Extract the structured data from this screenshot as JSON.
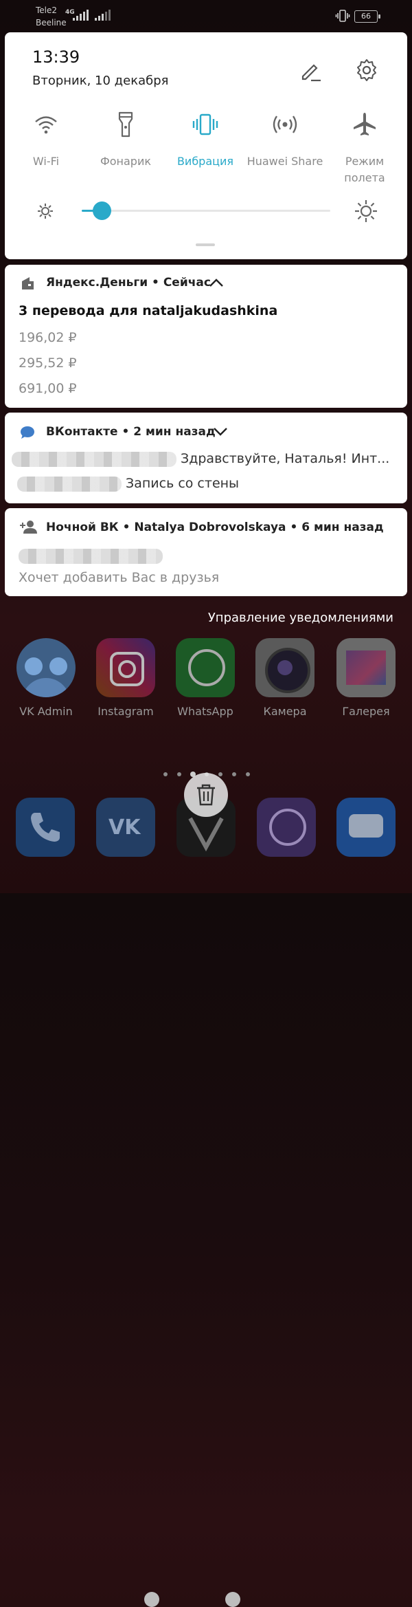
{
  "status_bar": {
    "carrier_1": "Tele2",
    "carrier_2": "Beeline",
    "network": "4G",
    "battery": "66"
  },
  "quick_settings": {
    "time": "13:39",
    "date": "Вторник, 10 декабря",
    "tiles": [
      {
        "label": "Wi-Fi",
        "icon": "wifi-icon",
        "active": false
      },
      {
        "label": "Фонарик",
        "icon": "flashlight-icon",
        "active": false
      },
      {
        "label": "Вибрация",
        "icon": "vibration-icon",
        "active": true
      },
      {
        "label": "Huawei Share",
        "icon": "huawei-share-icon",
        "active": false
      },
      {
        "label": "Режим\nполета",
        "icon": "airplane-icon",
        "active": false
      }
    ],
    "brightness": 0.08,
    "accent_color": "#29a9c9"
  },
  "notifications": [
    {
      "app": "Яндекс.Деньги • Сейчас",
      "title": "3 перевода для nataljakudashkina",
      "amounts": [
        "196,02 ₽",
        "295,52 ₽",
        "691,00 ₽"
      ]
    },
    {
      "app": "ВКонтакте • 2 мин назад",
      "line1_text": "Здравствуйте, Наталья! Инт...",
      "line2_text": "Запись со стены"
    },
    {
      "app": "Ночной ВК • Natalya Dobrovolskaya • 6 мин назад",
      "subtitle": "Хочет добавить Вас в друзья"
    }
  ],
  "manage_label": "Управление уведомлениями",
  "home_apps": [
    {
      "label": "VK Admin"
    },
    {
      "label": "Instagram"
    },
    {
      "label": "WhatsApp"
    },
    {
      "label": "Камера"
    },
    {
      "label": "Галерея"
    }
  ]
}
